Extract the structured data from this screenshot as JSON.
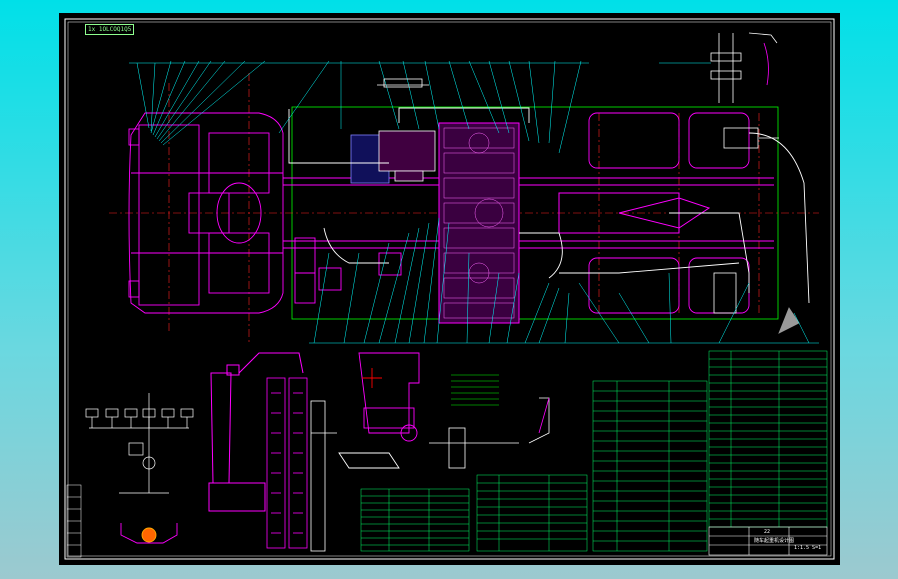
{
  "drawing": {
    "corner_tag": "1x 1OLCOQ1Q5",
    "title_block_lines": [
      "22",
      "随车起重机设计图",
      "1:1.5 S=1"
    ],
    "colors": {
      "background": "#000000",
      "frame": "#ffffff",
      "chassis": "#ff00ff",
      "leaders": "#00ffff",
      "table_text": "#00ff66",
      "centerline": "#ff2020",
      "outline_green": "#00ff00"
    }
  }
}
